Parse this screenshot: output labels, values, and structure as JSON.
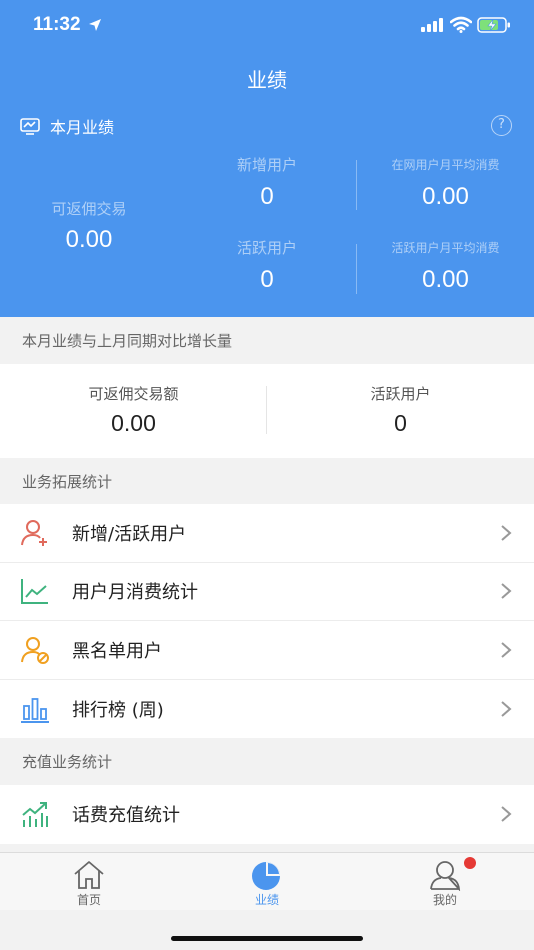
{
  "status": {
    "time": "11:32"
  },
  "header": {
    "title": "业绩",
    "month_label": "本月业绩",
    "help_glyph": "?",
    "rebate_label": "可返佣交易",
    "rebate_value": "0.00",
    "new_users_label": "新增用户",
    "new_users_value": "0",
    "active_users_label": "活跃用户",
    "active_users_value": "0",
    "net_avg_label": "在网用户月平均消费",
    "net_avg_value": "0.00",
    "active_avg_label": "活跃用户月平均消费",
    "active_avg_value": "0.00"
  },
  "compare": {
    "section_title": "本月业绩与上月同期对比增长量",
    "left_label": "可返佣交易额",
    "left_value": "0.00",
    "right_label": "活跃用户",
    "right_value": "0"
  },
  "expansion": {
    "section_title": "业务拓展统计",
    "items": [
      {
        "label": "新增/活跃用户",
        "icon": "add-user-icon"
      },
      {
        "label": "用户月消费统计",
        "icon": "line-chart-icon"
      },
      {
        "label": "黑名单用户",
        "icon": "blocked-user-icon"
      },
      {
        "label": "排行榜 (周)",
        "icon": "bar-chart-icon"
      }
    ]
  },
  "recharge": {
    "section_title": "充值业务统计",
    "items": [
      {
        "label": "话费充值统计",
        "icon": "trend-chart-icon"
      }
    ]
  },
  "tabbar": {
    "items": [
      {
        "label": "首页",
        "icon": "home-icon"
      },
      {
        "label": "业绩",
        "icon": "pie-chart-icon"
      },
      {
        "label": "我的",
        "icon": "profile-icon"
      }
    ]
  },
  "colors": {
    "accent": "#4b95ee",
    "badge": "#e53935",
    "add_user": "#e06a5c",
    "line_chart": "#3fb37f",
    "blocked_user": "#f0a020",
    "bar_chart": "#4b95ee"
  }
}
